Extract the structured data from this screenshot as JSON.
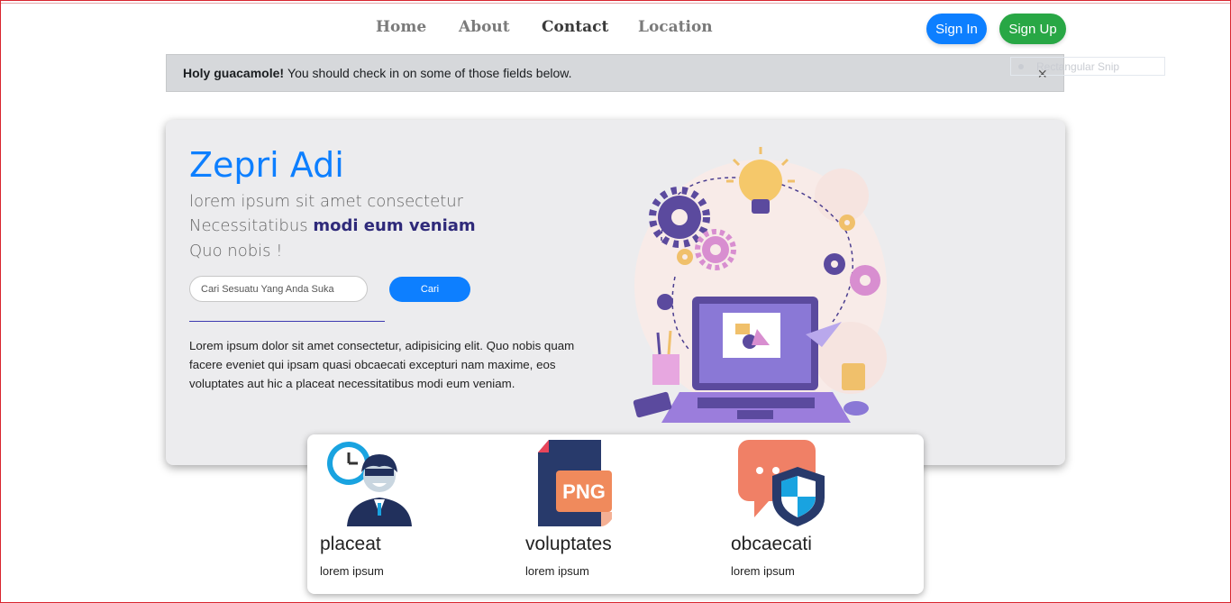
{
  "nav": {
    "items": [
      {
        "label": "Home",
        "active": false
      },
      {
        "label": "About",
        "active": false
      },
      {
        "label": "Contact",
        "active": true
      },
      {
        "label": "Location",
        "active": false
      }
    ],
    "signin_label": "Sign In",
    "signup_label": "Sign Up"
  },
  "alert": {
    "strong": "Holy guacamole!",
    "message": "You should check in on some of those fields below.",
    "close": "×"
  },
  "snip": {
    "label": "Rectangular Snip"
  },
  "hero": {
    "title": "Zepri Adi",
    "line1": "lorem ipsum sit amet consectetur",
    "line2_prefix": "Necessitatibus",
    "line2_highlight": "modi eum veniam",
    "line3": "Quo nobis !",
    "search_placeholder": "Cari Sesuatu Yang Anda Suka",
    "search_button": "Cari",
    "paragraph": "Lorem ipsum dolor sit amet consectetur, adipisicing elit. Quo nobis quam facere eveniet qui ipsam quasi obcaecati excepturi nam maxime, eos voluptates aut hic a placeat necessitatibus modi eum veniam."
  },
  "cards": [
    {
      "title": "placeat",
      "subtitle": "lorem ipsum",
      "icon": "user-clock-icon"
    },
    {
      "title": "voluptates",
      "subtitle": "lorem ipsum",
      "icon": "png-file-icon",
      "icon_text": "PNG"
    },
    {
      "title": "obcaecati",
      "subtitle": "lorem ipsum",
      "icon": "chat-shield-icon"
    }
  ],
  "colors": {
    "primary": "#0d7fff",
    "success": "#28a745",
    "alert_bg": "#d6d8db",
    "hero_bg": "#ececee"
  }
}
